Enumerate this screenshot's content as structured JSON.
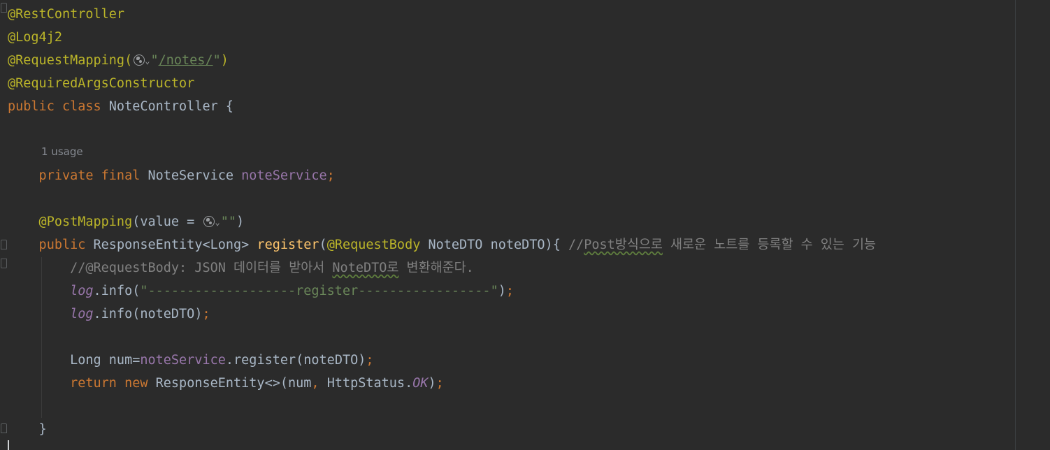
{
  "editor": {
    "usage_hint": "1 usage",
    "lines": [
      {
        "tokens": [
          {
            "t": "@RestController",
            "c": "ann"
          }
        ]
      },
      {
        "tokens": [
          {
            "t": "@Log4j2",
            "c": "ann"
          }
        ]
      },
      {
        "tokens": [
          {
            "t": "@RequestMapping(",
            "c": "ann"
          },
          {
            "icon": "globe"
          },
          {
            "t": "\"",
            "c": "str"
          },
          {
            "t": "/notes/",
            "c": "strlink"
          },
          {
            "t": "\"",
            "c": "str"
          },
          {
            "t": ")",
            "c": "ann"
          }
        ]
      },
      {
        "tokens": [
          {
            "t": "@RequiredArgsConstructor",
            "c": "ann"
          }
        ]
      },
      {
        "tokens": [
          {
            "t": "public ",
            "c": "kw"
          },
          {
            "t": "class ",
            "c": "kw"
          },
          {
            "t": "NoteController {",
            "c": "plain"
          }
        ]
      },
      {
        "tokens": []
      },
      {
        "tokens": [
          {
            "t": "    private ",
            "c": "kw"
          },
          {
            "t": "final ",
            "c": "kw"
          },
          {
            "t": "NoteService ",
            "c": "plain"
          },
          {
            "t": "noteService",
            "c": "field"
          },
          {
            "t": ";",
            "c": "kw"
          }
        ]
      },
      {
        "tokens": []
      },
      {
        "tokens": [
          {
            "t": "    @PostMapping",
            "c": "ann"
          },
          {
            "t": "(value = ",
            "c": "plain"
          },
          {
            "icon": "globe"
          },
          {
            "t": "\"\"",
            "c": "str"
          },
          {
            "t": ")",
            "c": "plain"
          }
        ]
      },
      {
        "tokens": [
          {
            "t": "    public ",
            "c": "kw"
          },
          {
            "t": "ResponseEntity<Long> ",
            "c": "plain"
          },
          {
            "t": "register",
            "c": "method"
          },
          {
            "t": "(",
            "c": "plain"
          },
          {
            "t": "@RequestBody ",
            "c": "ann"
          },
          {
            "t": "NoteDTO noteDTO){ ",
            "c": "plain"
          },
          {
            "t": "//",
            "c": "cmt"
          },
          {
            "t": "Post방식으로",
            "c": "cmt typo"
          },
          {
            "t": " 새로운 노트를 등록할 수 있는 기능",
            "c": "cmt"
          }
        ]
      },
      {
        "tokens": [
          {
            "t": "        //@RequestBody: JSON 데이터를 받아서 ",
            "c": "cmt"
          },
          {
            "t": "NoteDTO로",
            "c": "cmt typo"
          },
          {
            "t": " 변환해준다.",
            "c": "cmt"
          }
        ]
      },
      {
        "tokens": [
          {
            "t": "        ",
            "c": "plain"
          },
          {
            "t": "log",
            "c": "fieldi"
          },
          {
            "t": ".info(",
            "c": "plain"
          },
          {
            "t": "\"-------------------register-----------------\"",
            "c": "str"
          },
          {
            "t": ")",
            "c": "plain"
          },
          {
            "t": ";",
            "c": "kw"
          }
        ]
      },
      {
        "tokens": [
          {
            "t": "        ",
            "c": "plain"
          },
          {
            "t": "log",
            "c": "fieldi"
          },
          {
            "t": ".info(noteDTO)",
            "c": "plain"
          },
          {
            "t": ";",
            "c": "kw"
          }
        ]
      },
      {
        "tokens": []
      },
      {
        "tokens": [
          {
            "t": "        Long num=",
            "c": "plain"
          },
          {
            "t": "noteService",
            "c": "field"
          },
          {
            "t": ".register(noteDTO)",
            "c": "plain"
          },
          {
            "t": ";",
            "c": "kw"
          }
        ]
      },
      {
        "tokens": [
          {
            "t": "        return ",
            "c": "kw"
          },
          {
            "t": "new ",
            "c": "kw"
          },
          {
            "t": "ResponseEntity<>(num",
            "c": "plain"
          },
          {
            "t": ", ",
            "c": "kw"
          },
          {
            "t": "HttpStatus.",
            "c": "plain"
          },
          {
            "t": "OK",
            "c": "fieldi"
          },
          {
            "t": ")",
            "c": "plain"
          },
          {
            "t": ";",
            "c": "kw"
          }
        ]
      },
      {
        "tokens": []
      },
      {
        "tokens": [
          {
            "t": "    }",
            "c": "plain"
          }
        ]
      }
    ]
  }
}
